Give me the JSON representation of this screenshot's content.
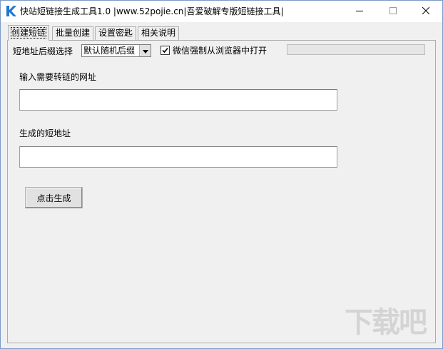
{
  "window": {
    "title": "快站短链接生成工具1.0 |www.52pojie.cn|吾爱破解专版短链接工具|"
  },
  "tabs": [
    {
      "label": "创建短链",
      "active": true
    },
    {
      "label": "批量创建",
      "active": false
    },
    {
      "label": "设置密匙",
      "active": false
    },
    {
      "label": "相关说明",
      "active": false
    }
  ],
  "options": {
    "suffix_label": "短地址后缀选择",
    "suffix_value": "默认随机后缀",
    "wechat_checkbox_label": "微信强制从浏览器中打开",
    "wechat_checked": true
  },
  "form": {
    "input_url_label": "输入需要转链的网址",
    "input_url_value": "",
    "output_label": "生成的短地址",
    "output_value": "",
    "generate_button": "点击生成"
  },
  "watermark": {
    "text": "下载吧"
  },
  "colors": {
    "window_border": "#7a9cc6",
    "app_icon": "#1e78d2",
    "panel_bg": "#f0f0f0"
  }
}
